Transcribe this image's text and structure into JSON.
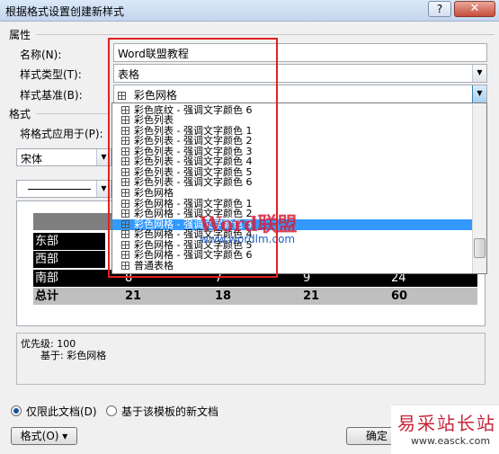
{
  "window": {
    "title": "根据格式设置创建新样式",
    "help_label": "?",
    "close_label": "✕"
  },
  "properties": {
    "group_label": "属性",
    "name_label": "名称(N):",
    "name_value": "Word联盟教程",
    "type_label": "样式类型(T):",
    "type_value": "表格",
    "base_label": "样式基准(B):",
    "base_value": "彩色网格"
  },
  "format": {
    "group_label": "格式",
    "apply_label": "将格式应用于(P):",
    "font_value": "宋体"
  },
  "dropdown_items": [
    "彩色底纹 - 强调文字颜色 6",
    "彩色列表",
    "彩色列表 - 强调文字颜色 1",
    "彩色列表 - 强调文字颜色 2",
    "彩色列表 - 强调文字颜色 3",
    "彩色列表 - 强调文字颜色 4",
    "彩色列表 - 强调文字颜色 5",
    "彩色列表 - 强调文字颜色 6",
    "彩色网格",
    "彩色网格 - 强调文字颜色 1",
    "彩色网格 - 强调文字颜色 2",
    "彩色网格 - 强调文字颜色 3",
    "彩色网格 - 强调文字颜色 4",
    "彩色网格 - 强调文字颜色 5",
    "彩色网格 - 强调文字颜色 6",
    "普通表格"
  ],
  "watermark": {
    "logo": "Word联盟",
    "url": "www.wordlm.com"
  },
  "preview": {
    "rows": [
      {
        "label": "东部",
        "c1": "",
        "c2": "",
        "c3": "",
        "c4": ""
      },
      {
        "label": "西部",
        "c1": "",
        "c2": "",
        "c3": "",
        "c4": ""
      },
      {
        "label": "南部",
        "c1": "8",
        "c2": "7",
        "c3": "9",
        "c4": "24"
      }
    ],
    "total": {
      "label": "总计",
      "c1": "21",
      "c2": "18",
      "c3": "21",
      "c4": "60"
    }
  },
  "description": {
    "priority": "优先级: 100",
    "based_on": "基于: 彩色网格"
  },
  "options": {
    "only_doc": "仅限此文档(D)",
    "new_docs": "基于该模板的新文档"
  },
  "buttons": {
    "format": "格式(O) ▾",
    "ok": "确定"
  },
  "brand": {
    "name": "易采站长站",
    "url": "www.easck.com"
  },
  "colors": {
    "selection": "#3399ff",
    "highlight_box": "#e02020"
  }
}
